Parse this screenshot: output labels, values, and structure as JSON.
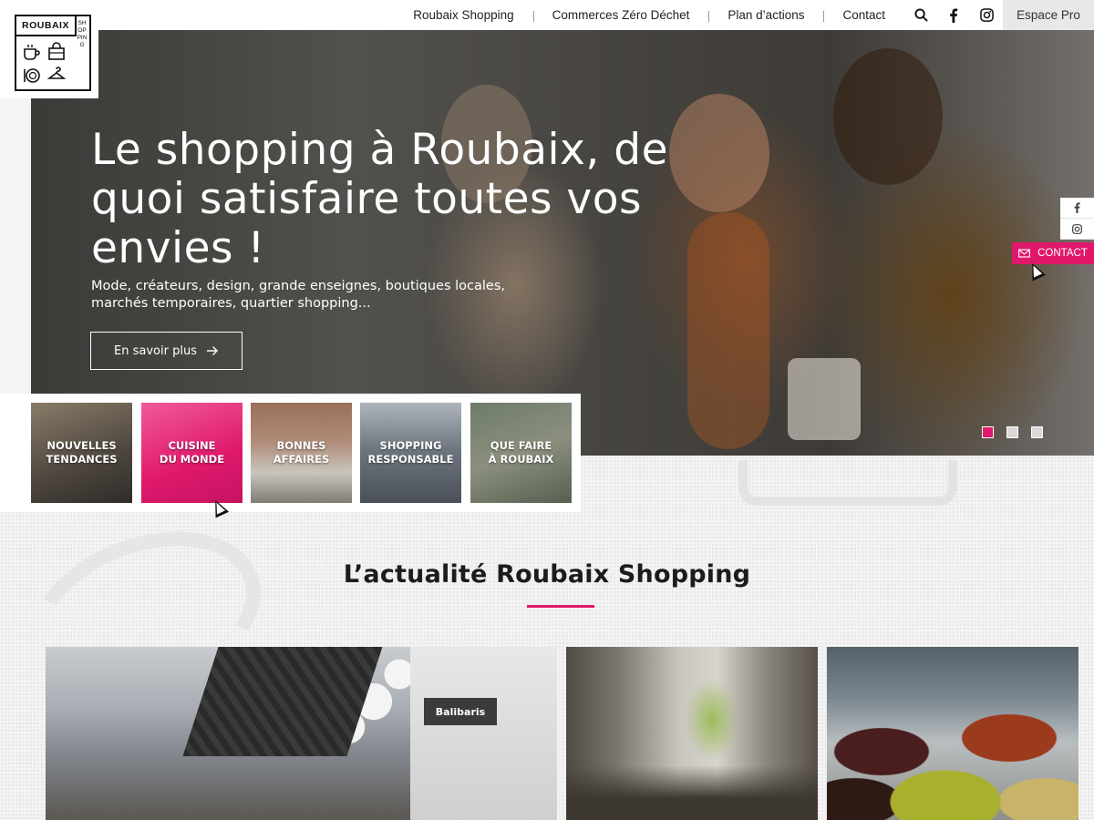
{
  "brand": {
    "logo_word": "ROUBAIX",
    "logo_vertical": "SHOPPING",
    "accent_color": "#e0186c"
  },
  "nav": {
    "items": [
      "Roubaix Shopping",
      "Commerces Zéro Déchet",
      "Plan d’actions",
      "Contact"
    ],
    "search_icon": "search-icon",
    "facebook_icon": "facebook-icon",
    "instagram_icon": "instagram-icon",
    "espace_pro": "Espace Pro"
  },
  "hero": {
    "title": "Le shopping à Roubaix, de quoi satisfaire toutes vos envies !",
    "subtitle": "Mode, créateurs, design, grande enseignes, boutiques locales, marchés temporaires, quartier shopping...",
    "button_label": "En savoir plus",
    "slides": 3,
    "active_slide": 1
  },
  "side_social": {
    "contact_label": "CONTACT"
  },
  "categories": [
    {
      "label": "NOUVELLES\nTENDANCES"
    },
    {
      "label": "CUISINE\nDU MONDE"
    },
    {
      "label": "BONNES\nAFFAIRES"
    },
    {
      "label": "SHOPPING\nRESPONSABLE"
    },
    {
      "label": "QUE FAIRE\nÀ ROUBAIX"
    }
  ],
  "news": {
    "title": "L’actualité Roubaix Shopping",
    "cards": [
      {
        "sign_text": "Balibaris"
      },
      {},
      {}
    ]
  }
}
